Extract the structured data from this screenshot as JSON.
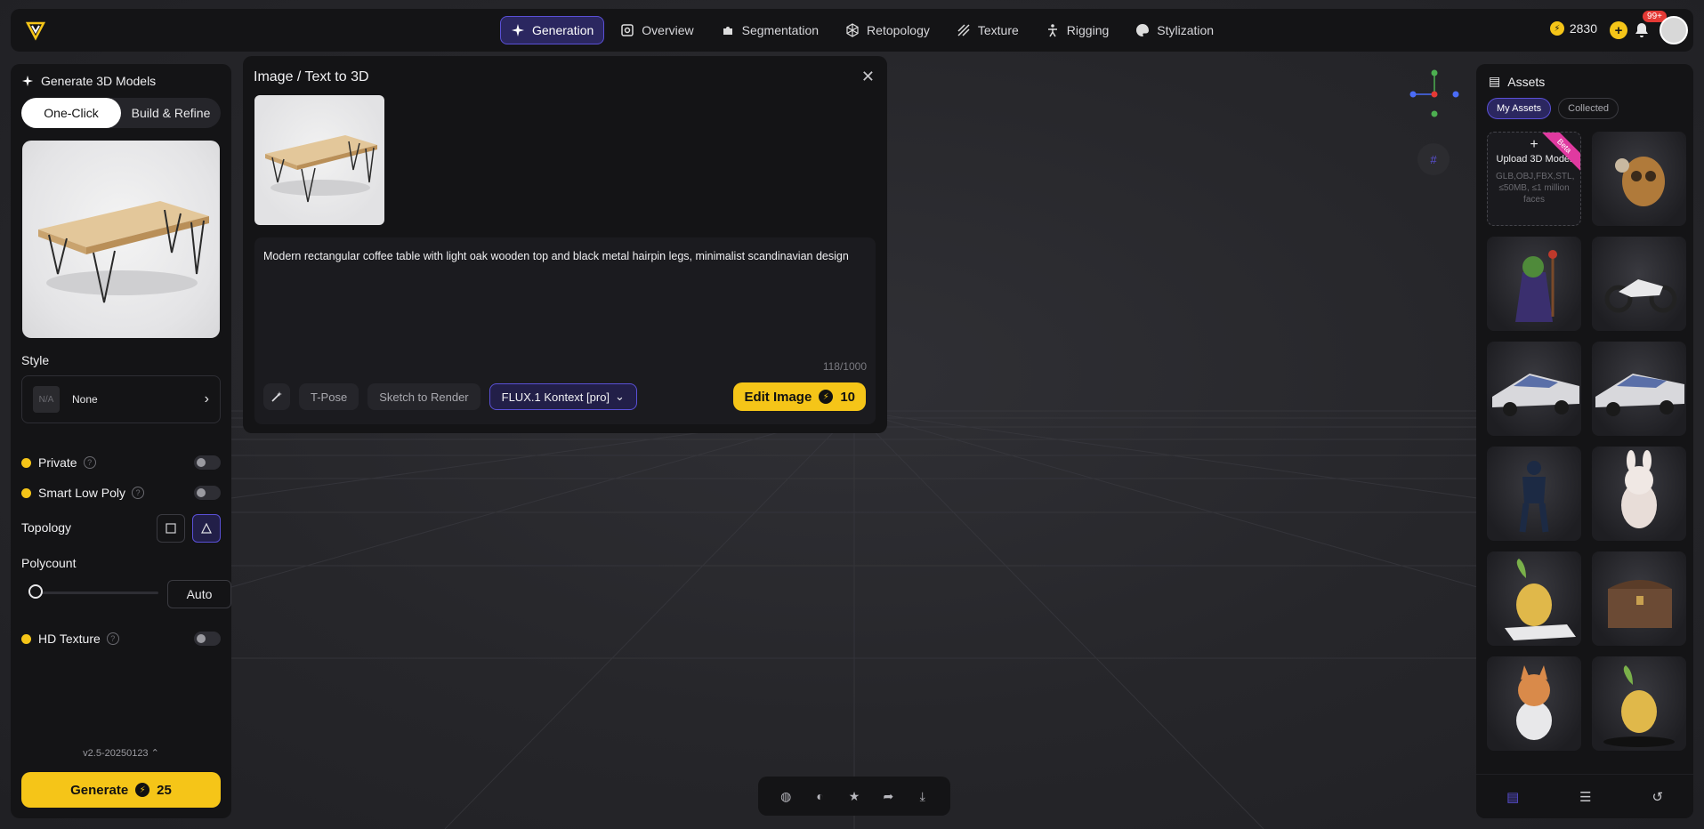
{
  "nav": {
    "items": [
      {
        "label": "Generation",
        "icon": "sparkle-icon",
        "active": true
      },
      {
        "label": "Overview",
        "icon": "scan-icon"
      },
      {
        "label": "Segmentation",
        "icon": "puzzle-icon"
      },
      {
        "label": "Retopology",
        "icon": "mesh-icon"
      },
      {
        "label": "Texture",
        "icon": "texture-icon"
      },
      {
        "label": "Rigging",
        "icon": "figure-icon"
      },
      {
        "label": "Stylization",
        "icon": "palette-icon"
      }
    ],
    "credits": "2830",
    "notifications_badge": "99+"
  },
  "left_panel": {
    "title": "Generate 3D Models",
    "mode_tabs": [
      "One-Click",
      "Build & Refine"
    ],
    "style_label": "Style",
    "style_na": "N/A",
    "style_value": "None",
    "private_label": "Private",
    "smart_low_poly_label": "Smart Low Poly",
    "topology_label": "Topology",
    "polycount_label": "Polycount",
    "polycount_value": "Auto",
    "hd_texture_label": "HD Texture",
    "version": "v2.5-20250123",
    "generate_label": "Generate",
    "generate_cost": "25"
  },
  "dialog": {
    "title": "Image / Text to 3D",
    "prompt": "Modern rectangular coffee table with light oak wooden top and black metal hairpin legs, minimalist scandinavian design",
    "char_count": "118/1000",
    "tpose_label": "T-Pose",
    "sketch_label": "Sketch to Render",
    "model_label": "FLUX.1 Kontext [pro]",
    "edit_label": "Edit Image",
    "edit_cost": "10"
  },
  "assets_panel": {
    "title": "Assets",
    "tabs": [
      "My Assets",
      "Collected"
    ],
    "upload_title": "Upload 3D Model",
    "upload_sub": "GLB,OBJ,FBX,STL, ≤50MB, ≤1 million faces",
    "beta_label": "Beta"
  },
  "colors": {
    "accent": "#5a50d6",
    "brand_yellow": "#f5c518",
    "panel_bg": "#141416"
  }
}
